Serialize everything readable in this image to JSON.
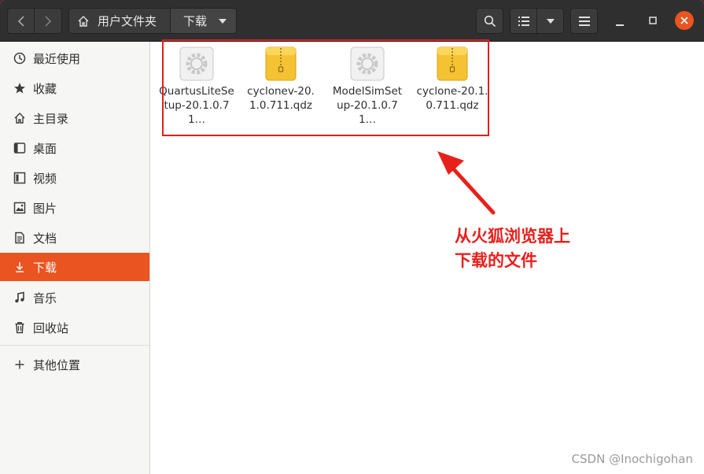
{
  "headerbar": {
    "path": [
      "用户文件夹",
      "下载"
    ]
  },
  "sidebar": {
    "items": [
      {
        "label": "最近使用",
        "icon": "clock-icon"
      },
      {
        "label": "收藏",
        "icon": "star-icon"
      },
      {
        "label": "主目录",
        "icon": "home-icon"
      },
      {
        "label": "桌面",
        "icon": "desktop-icon"
      },
      {
        "label": "视频",
        "icon": "video-icon"
      },
      {
        "label": "图片",
        "icon": "image-icon"
      },
      {
        "label": "文档",
        "icon": "document-icon"
      },
      {
        "label": "下载",
        "icon": "download-icon",
        "active": true
      },
      {
        "label": "音乐",
        "icon": "music-icon"
      },
      {
        "label": "回收站",
        "icon": "trash-icon"
      }
    ],
    "other_locations": "其他位置"
  },
  "files": [
    {
      "name": "QuartusLiteSetup-20.1.0.71…",
      "type": "executable"
    },
    {
      "name": "cyclonev-20.1.0.711.qdz",
      "type": "archive"
    },
    {
      "name": "ModelSimSetup-20.1.0.71…",
      "type": "executable"
    },
    {
      "name": "cyclone-20.1.0.711.qdz",
      "type": "archive"
    }
  ],
  "annotation": {
    "line1": "从火狐浏览器上",
    "line2": "下载的文件"
  },
  "watermark": "CSDN @Inochigohan",
  "colors": {
    "accent": "#e95420",
    "annotation": "#e8201c",
    "headerbar": "#2f2f2f",
    "close_button": "#e95420"
  }
}
